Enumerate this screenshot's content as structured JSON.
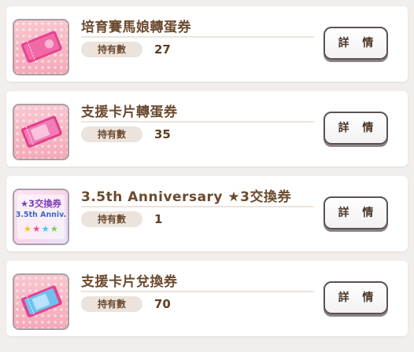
{
  "items": [
    {
      "title": "培育賽馬娘轉蛋券",
      "owned_label": "持有數",
      "count": "27",
      "button_label": "詳 情",
      "icon": "pink-gacha-ticket-icon"
    },
    {
      "title": "支援卡片轉蛋券",
      "owned_label": "持有數",
      "count": "35",
      "button_label": "詳 情",
      "icon": "support-card-gacha-ticket-icon"
    },
    {
      "title": "3.5th Anniversary ★3交換券",
      "owned_label": "持有數",
      "count": "1",
      "button_label": "詳 情",
      "icon": "anniversary-exchange-ticket-icon",
      "icon_text": {
        "line1": "★3交換券",
        "line2": "3.5th Anniv."
      }
    },
    {
      "title": "支援卡片兌換券",
      "owned_label": "持有數",
      "count": "70",
      "button_label": "詳 情",
      "icon": "support-card-exchange-ticket-icon"
    }
  ],
  "colors": {
    "title": "#6b4a2e",
    "label_bg": "#ebe3dc",
    "card_bg": "#ffffff",
    "page_bg": "#f1eeec",
    "thumb_pink": "#f5a9b8",
    "ticket_magenta": "#e8408f",
    "ticket_blue": "#6fc0ee"
  }
}
